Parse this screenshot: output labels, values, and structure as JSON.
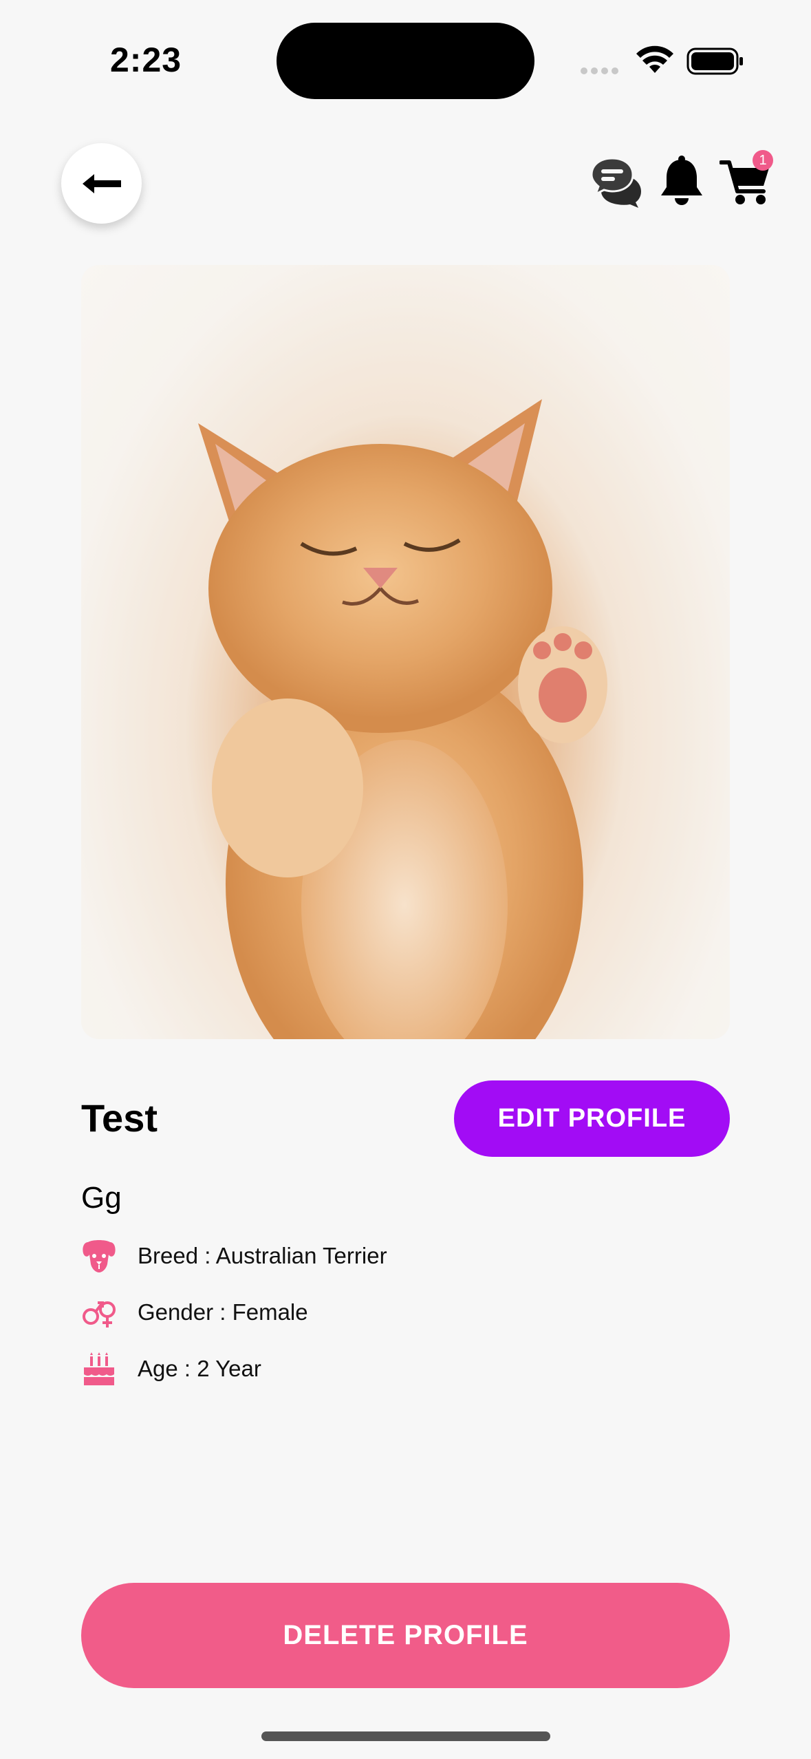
{
  "status_bar": {
    "time": "2:23"
  },
  "header": {
    "back_icon": "arrow-left-icon",
    "icons": [
      "chat-icon",
      "bell-icon",
      "cart-icon"
    ],
    "cart_count": "1"
  },
  "pet": {
    "name": "Test",
    "description": "Gg",
    "attributes": [
      {
        "icon": "dog-icon",
        "text": "Breed : Australian Terrier"
      },
      {
        "icon": "gender-icon",
        "text": "Gender : Female"
      },
      {
        "icon": "cake-icon",
        "text": "Age : 2 Year"
      }
    ]
  },
  "actions": {
    "edit_label": "EDIT PROFILE",
    "delete_label": "DELETE PROFILE"
  },
  "colors": {
    "edit_button": "#a20cf5",
    "delete_button": "#f15c89",
    "accent_icon": "#f05a8a",
    "background": "#f7f7f7"
  }
}
